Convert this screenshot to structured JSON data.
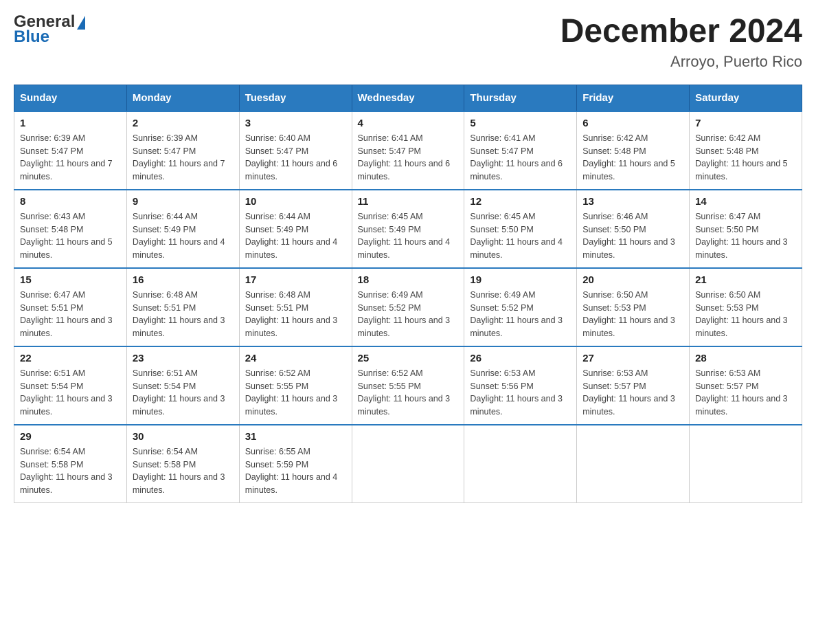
{
  "header": {
    "title": "December 2024",
    "subtitle": "Arroyo, Puerto Rico",
    "logo_general": "General",
    "logo_blue": "Blue"
  },
  "weekdays": [
    "Sunday",
    "Monday",
    "Tuesday",
    "Wednesday",
    "Thursday",
    "Friday",
    "Saturday"
  ],
  "weeks": [
    [
      {
        "day": "1",
        "sunrise": "6:39 AM",
        "sunset": "5:47 PM",
        "daylight": "11 hours and 7 minutes."
      },
      {
        "day": "2",
        "sunrise": "6:39 AM",
        "sunset": "5:47 PM",
        "daylight": "11 hours and 7 minutes."
      },
      {
        "day": "3",
        "sunrise": "6:40 AM",
        "sunset": "5:47 PM",
        "daylight": "11 hours and 6 minutes."
      },
      {
        "day": "4",
        "sunrise": "6:41 AM",
        "sunset": "5:47 PM",
        "daylight": "11 hours and 6 minutes."
      },
      {
        "day": "5",
        "sunrise": "6:41 AM",
        "sunset": "5:47 PM",
        "daylight": "11 hours and 6 minutes."
      },
      {
        "day": "6",
        "sunrise": "6:42 AM",
        "sunset": "5:48 PM",
        "daylight": "11 hours and 5 minutes."
      },
      {
        "day": "7",
        "sunrise": "6:42 AM",
        "sunset": "5:48 PM",
        "daylight": "11 hours and 5 minutes."
      }
    ],
    [
      {
        "day": "8",
        "sunrise": "6:43 AM",
        "sunset": "5:48 PM",
        "daylight": "11 hours and 5 minutes."
      },
      {
        "day": "9",
        "sunrise": "6:44 AM",
        "sunset": "5:49 PM",
        "daylight": "11 hours and 4 minutes."
      },
      {
        "day": "10",
        "sunrise": "6:44 AM",
        "sunset": "5:49 PM",
        "daylight": "11 hours and 4 minutes."
      },
      {
        "day": "11",
        "sunrise": "6:45 AM",
        "sunset": "5:49 PM",
        "daylight": "11 hours and 4 minutes."
      },
      {
        "day": "12",
        "sunrise": "6:45 AM",
        "sunset": "5:50 PM",
        "daylight": "11 hours and 4 minutes."
      },
      {
        "day": "13",
        "sunrise": "6:46 AM",
        "sunset": "5:50 PM",
        "daylight": "11 hours and 3 minutes."
      },
      {
        "day": "14",
        "sunrise": "6:47 AM",
        "sunset": "5:50 PM",
        "daylight": "11 hours and 3 minutes."
      }
    ],
    [
      {
        "day": "15",
        "sunrise": "6:47 AM",
        "sunset": "5:51 PM",
        "daylight": "11 hours and 3 minutes."
      },
      {
        "day": "16",
        "sunrise": "6:48 AM",
        "sunset": "5:51 PM",
        "daylight": "11 hours and 3 minutes."
      },
      {
        "day": "17",
        "sunrise": "6:48 AM",
        "sunset": "5:51 PM",
        "daylight": "11 hours and 3 minutes."
      },
      {
        "day": "18",
        "sunrise": "6:49 AM",
        "sunset": "5:52 PM",
        "daylight": "11 hours and 3 minutes."
      },
      {
        "day": "19",
        "sunrise": "6:49 AM",
        "sunset": "5:52 PM",
        "daylight": "11 hours and 3 minutes."
      },
      {
        "day": "20",
        "sunrise": "6:50 AM",
        "sunset": "5:53 PM",
        "daylight": "11 hours and 3 minutes."
      },
      {
        "day": "21",
        "sunrise": "6:50 AM",
        "sunset": "5:53 PM",
        "daylight": "11 hours and 3 minutes."
      }
    ],
    [
      {
        "day": "22",
        "sunrise": "6:51 AM",
        "sunset": "5:54 PM",
        "daylight": "11 hours and 3 minutes."
      },
      {
        "day": "23",
        "sunrise": "6:51 AM",
        "sunset": "5:54 PM",
        "daylight": "11 hours and 3 minutes."
      },
      {
        "day": "24",
        "sunrise": "6:52 AM",
        "sunset": "5:55 PM",
        "daylight": "11 hours and 3 minutes."
      },
      {
        "day": "25",
        "sunrise": "6:52 AM",
        "sunset": "5:55 PM",
        "daylight": "11 hours and 3 minutes."
      },
      {
        "day": "26",
        "sunrise": "6:53 AM",
        "sunset": "5:56 PM",
        "daylight": "11 hours and 3 minutes."
      },
      {
        "day": "27",
        "sunrise": "6:53 AM",
        "sunset": "5:57 PM",
        "daylight": "11 hours and 3 minutes."
      },
      {
        "day": "28",
        "sunrise": "6:53 AM",
        "sunset": "5:57 PM",
        "daylight": "11 hours and 3 minutes."
      }
    ],
    [
      {
        "day": "29",
        "sunrise": "6:54 AM",
        "sunset": "5:58 PM",
        "daylight": "11 hours and 3 minutes."
      },
      {
        "day": "30",
        "sunrise": "6:54 AM",
        "sunset": "5:58 PM",
        "daylight": "11 hours and 3 minutes."
      },
      {
        "day": "31",
        "sunrise": "6:55 AM",
        "sunset": "5:59 PM",
        "daylight": "11 hours and 4 minutes."
      },
      null,
      null,
      null,
      null
    ]
  ],
  "labels": {
    "sunrise": "Sunrise:",
    "sunset": "Sunset:",
    "daylight": "Daylight:"
  }
}
